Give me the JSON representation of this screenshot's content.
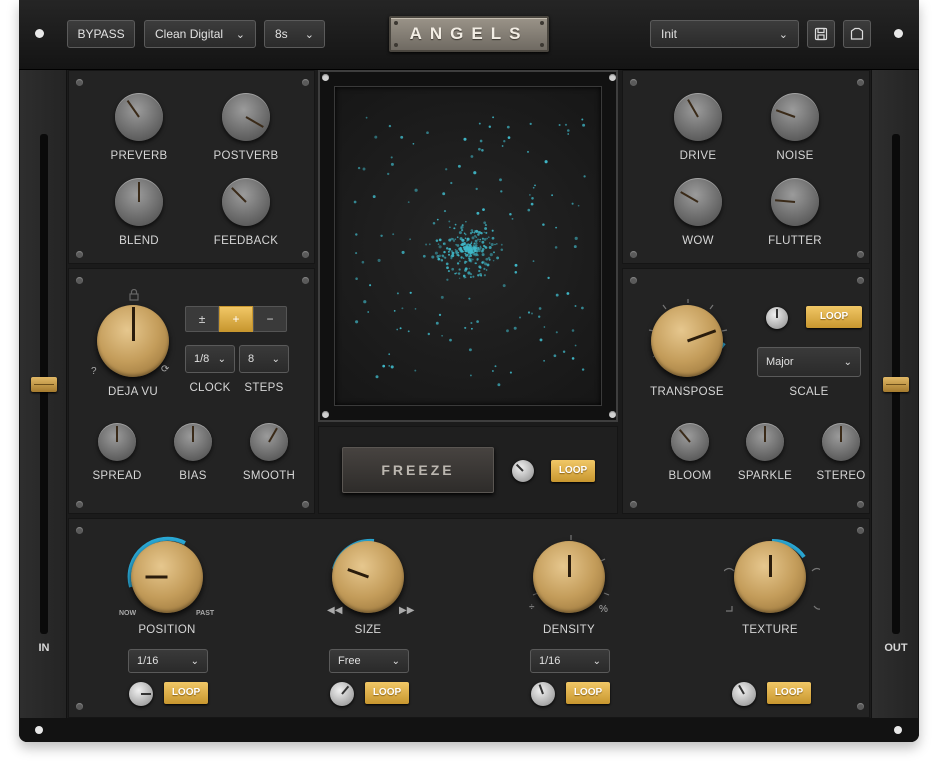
{
  "header": {
    "bypass": "BYPASS",
    "mode": "Clean Digital",
    "time": "8s",
    "logo": "ANGELS",
    "preset": "Init",
    "save_icon": "save-icon",
    "folder_icon": "folder-icon"
  },
  "faders": {
    "in_label": "IN",
    "out_label": "OUT",
    "in_level": 0.5,
    "out_level": 0.5
  },
  "top_left": {
    "preverb": "PREVERB",
    "postverb": "POSTVERB",
    "blend": "BLEND",
    "feedback": "FEEDBACK"
  },
  "top_right": {
    "drive": "DRIVE",
    "noise": "NOISE",
    "wow": "WOW",
    "flutter": "FLUTTER"
  },
  "deja_vu": {
    "label": "DEJA VU",
    "help": "?",
    "buttons": [
      "±",
      "+",
      "−"
    ],
    "active_button": "+",
    "clock_value": "1/8",
    "clock_label": "CLOCK",
    "steps_value": "8",
    "steps_label": "STEPS",
    "spread": "SPREAD",
    "bias": "BIAS",
    "smooth": "SMOOTH"
  },
  "center": {
    "freeze": "FREEZE",
    "loop": "LOOP"
  },
  "transpose": {
    "label": "TRANSPOSE",
    "loop": "LOOP",
    "scale_value": "Major",
    "scale_label": "SCALE",
    "bloom": "BLOOM",
    "sparkle": "SPARKLE",
    "stereo": "STEREO"
  },
  "bottom": {
    "position": {
      "label": "POSITION",
      "now": "NOW",
      "past": "PAST",
      "select": "1/16",
      "loop": "LOOP"
    },
    "size": {
      "label": "SIZE",
      "select": "Free",
      "loop": "LOOP"
    },
    "density": {
      "label": "DENSITY",
      "select": "1/16",
      "loop": "LOOP"
    },
    "texture": {
      "label": "TEXTURE",
      "loop": "LOOP"
    }
  },
  "colors": {
    "accent": "#e8b94a",
    "particle": "#3fb8c8",
    "arc": "#2aa9d6"
  }
}
